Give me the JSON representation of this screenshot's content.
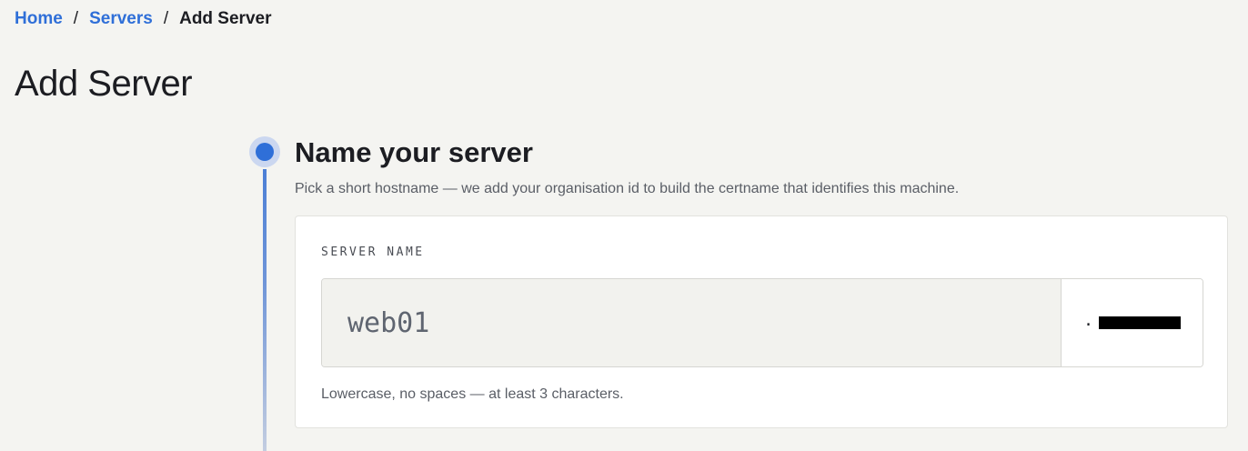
{
  "breadcrumb": {
    "home": "Home",
    "servers": "Servers",
    "current": "Add Server",
    "separator": "/"
  },
  "page": {
    "title": "Add Server"
  },
  "step": {
    "title": "Name your server",
    "description": "Pick a short hostname — we add your organisation id to build the certname that identifies this machine."
  },
  "form": {
    "server_name_label": "SERVER NAME",
    "server_name_value": "web01",
    "suffix_prefix": ".",
    "hint": "Lowercase, no spaces — at least 3 characters."
  },
  "colors": {
    "accent": "#2f6fd8",
    "background": "#f4f4f1",
    "card": "#ffffff"
  }
}
